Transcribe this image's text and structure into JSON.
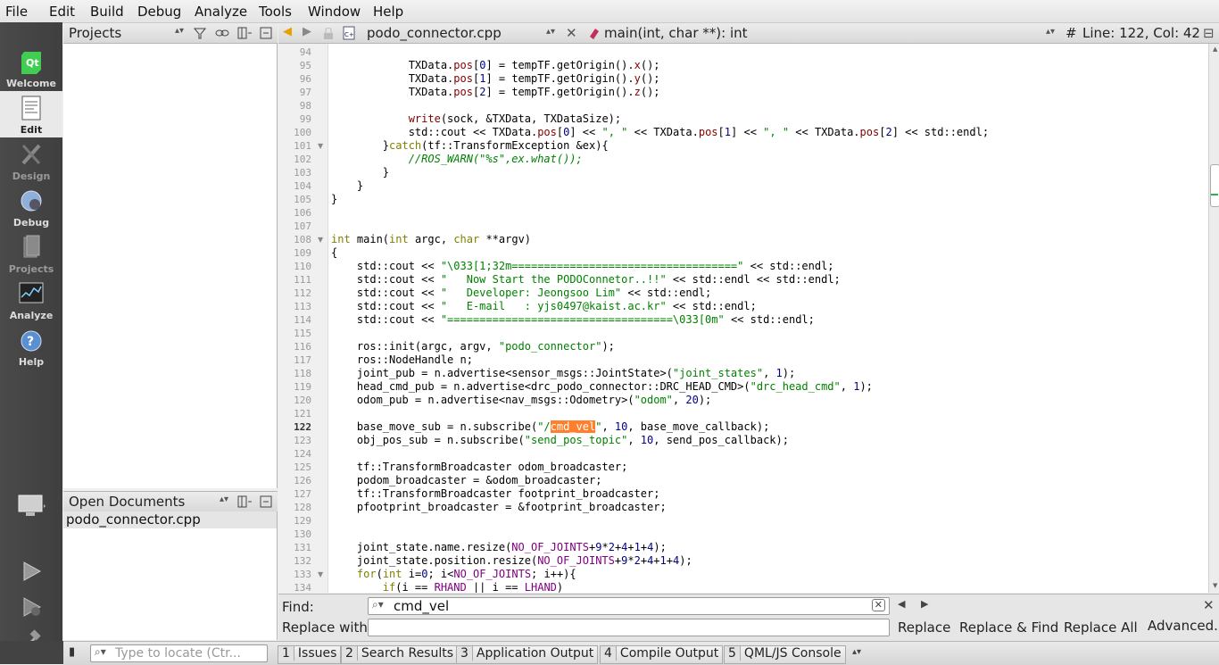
{
  "menu": [
    "File",
    "Edit",
    "Build",
    "Debug",
    "Analyze",
    "Tools",
    "Window",
    "Help"
  ],
  "modes": [
    {
      "label": "Welcome",
      "state": "normal"
    },
    {
      "label": "Edit",
      "state": "active"
    },
    {
      "label": "Design",
      "state": "dim"
    },
    {
      "label": "Debug",
      "state": "normal"
    },
    {
      "label": "Projects",
      "state": "dim"
    },
    {
      "label": "Analyze",
      "state": "normal"
    },
    {
      "label": "Help",
      "state": "normal"
    }
  ],
  "projects_title": "Projects",
  "open_docs_title": "Open Documents",
  "open_docs": [
    "podo_connector.cpp"
  ],
  "editor": {
    "file_name": "podo_connector.cpp",
    "function": "main(int, char **): int",
    "position": "Line: 122, Col: 42",
    "hash": "#"
  },
  "current_line": 122,
  "fold_lines": [
    101,
    108,
    133
  ],
  "code_lines": [
    {
      "n": 94,
      "t": ""
    },
    {
      "n": 95,
      "t": "            TXData.pos[0] = tempTF.getOrigin().x();"
    },
    {
      "n": 96,
      "t": "            TXData.pos[1] = tempTF.getOrigin().y();"
    },
    {
      "n": 97,
      "t": "            TXData.pos[2] = tempTF.getOrigin().z();"
    },
    {
      "n": 98,
      "t": ""
    },
    {
      "n": 99,
      "t": "            write(sock, &TXData, TXDataSize);"
    },
    {
      "n": 100,
      "t": "            std::cout << TXData.pos[0] << \", \" << TXData.pos[1] << \", \" << TXData.pos[2] << std::endl;"
    },
    {
      "n": 101,
      "t": "        }catch(tf::TransformException &ex){"
    },
    {
      "n": 102,
      "t": "            //ROS_WARN(\"%s\",ex.what());"
    },
    {
      "n": 103,
      "t": "        }"
    },
    {
      "n": 104,
      "t": "    }"
    },
    {
      "n": 105,
      "t": "}"
    },
    {
      "n": 106,
      "t": ""
    },
    {
      "n": 107,
      "t": ""
    },
    {
      "n": 108,
      "t": "int main(int argc, char **argv)"
    },
    {
      "n": 109,
      "t": "{"
    },
    {
      "n": 110,
      "t": "    std::cout << \"\\033[1;32m===================================\" << std::endl;"
    },
    {
      "n": 111,
      "t": "    std::cout << \"   Now Start the PODOConnetor..!!\" << std::endl << std::endl;"
    },
    {
      "n": 112,
      "t": "    std::cout << \"   Developer: Jeongsoo Lim\" << std::endl;"
    },
    {
      "n": 113,
      "t": "    std::cout << \"   E-mail   : yjs0497@kaist.ac.kr\" << std::endl;"
    },
    {
      "n": 114,
      "t": "    std::cout << \"===================================\\033[0m\" << std::endl;"
    },
    {
      "n": 115,
      "t": ""
    },
    {
      "n": 116,
      "t": "    ros::init(argc, argv, \"podo_connector\");"
    },
    {
      "n": 117,
      "t": "    ros::NodeHandle n;"
    },
    {
      "n": 118,
      "t": "    joint_pub = n.advertise<sensor_msgs::JointState>(\"joint_states\", 1);"
    },
    {
      "n": 119,
      "t": "    head_cmd_pub = n.advertise<drc_podo_connector::DRC_HEAD_CMD>(\"drc_head_cmd\", 1);"
    },
    {
      "n": 120,
      "t": "    odom_pub = n.advertise<nav_msgs::Odometry>(\"odom\", 20);"
    },
    {
      "n": 121,
      "t": ""
    },
    {
      "n": 122,
      "t": "    base_move_sub = n.subscribe(\"/cmd_vel\", 10, base_move_callback);"
    },
    {
      "n": 123,
      "t": "    obj_pos_sub = n.subscribe(\"send_pos_topic\", 10, send_pos_callback);"
    },
    {
      "n": 124,
      "t": ""
    },
    {
      "n": 125,
      "t": "    tf::TransformBroadcaster odom_broadcaster;"
    },
    {
      "n": 126,
      "t": "    podom_broadcaster = &odom_broadcaster;"
    },
    {
      "n": 127,
      "t": "    tf::TransformBroadcaster footprint_broadcaster;"
    },
    {
      "n": 128,
      "t": "    pfootprint_broadcaster = &footprint_broadcaster;"
    },
    {
      "n": 129,
      "t": ""
    },
    {
      "n": 130,
      "t": ""
    },
    {
      "n": 131,
      "t": "    joint_state.name.resize(NO_OF_JOINTS+9*2+4+1+4);"
    },
    {
      "n": 132,
      "t": "    joint_state.position.resize(NO_OF_JOINTS+9*2+4+1+4);"
    },
    {
      "n": 133,
      "t": "    for(int i=0; i<NO_OF_JOINTS; i++){"
    },
    {
      "n": 134,
      "t": "        if(i == RHAND || i == LHAND)"
    }
  ],
  "find": {
    "find_label": "Find:",
    "find_value": "cmd_vel",
    "replace_label": "Replace with:",
    "replace_value": "",
    "replace_btn": "Replace",
    "replace_find_btn": "Replace & Find",
    "replace_all_btn": "Replace All",
    "advanced_btn": "Advanced..."
  },
  "locator_placeholder": "Type to locate (Ctr...",
  "output_tabs": [
    {
      "n": "1",
      "label": "Issues"
    },
    {
      "n": "2",
      "label": "Search Results"
    },
    {
      "n": "3",
      "label": "Application Output"
    },
    {
      "n": "4",
      "label": "Compile Output"
    },
    {
      "n": "5",
      "label": "QML/JS Console"
    }
  ],
  "colors": {
    "keyword": "#808000",
    "string": "#008000",
    "highlight": "#ff7f2a",
    "member": "#800000",
    "macro": "#800080"
  }
}
